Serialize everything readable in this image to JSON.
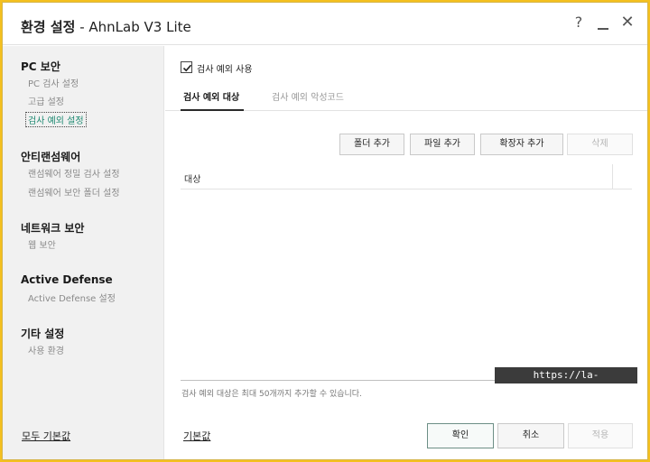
{
  "window": {
    "title_bold": "환경 설정",
    "title_app": "AhnLab V3 Lite",
    "help_glyph": "?",
    "close_glyph": "✕"
  },
  "sidebar": {
    "sections": [
      {
        "title": "PC 보안",
        "items": [
          "PC 검사 설정",
          "고급 설정",
          "검사 예외 설정"
        ]
      },
      {
        "title": "안티랜섬웨어",
        "items": [
          "랜섬웨어 정밀 검사 설정",
          "랜섬웨어 보안 폴더 설정"
        ]
      },
      {
        "title": "네트워크 보안",
        "items": [
          "웹 보안"
        ]
      },
      {
        "title": "Active Defense",
        "items": [
          "Active Defense 설정"
        ]
      },
      {
        "title": "기타 설정",
        "items": [
          "사용 환경"
        ]
      }
    ],
    "active_item": "검사 예외 설정",
    "reset_all_label": "모두 기본값"
  },
  "main": {
    "enable_exceptions_label": "검사 예외 사용",
    "enable_exceptions_checked": true,
    "tabs": [
      "검사 예외 대상",
      "검사 예외 악성코드"
    ],
    "active_tab": 0,
    "buttons": {
      "add_folder": "폴더 추가",
      "add_file": "파일 추가",
      "add_extension": "확장자 추가",
      "delete": "삭제"
    },
    "list": {
      "columns": [
        "대상"
      ],
      "rows": []
    },
    "note": "검사 예외 대상은 최대 50개까지 추가할 수 있습니다.",
    "reset_label": "기본값",
    "ok_label": "확인",
    "cancel_label": "취소",
    "apply_label": "적용"
  },
  "watermark": "https://la-nube.tistory.com",
  "colors": {
    "frame": "#f4c01e",
    "active_item": "#1f8a72"
  }
}
